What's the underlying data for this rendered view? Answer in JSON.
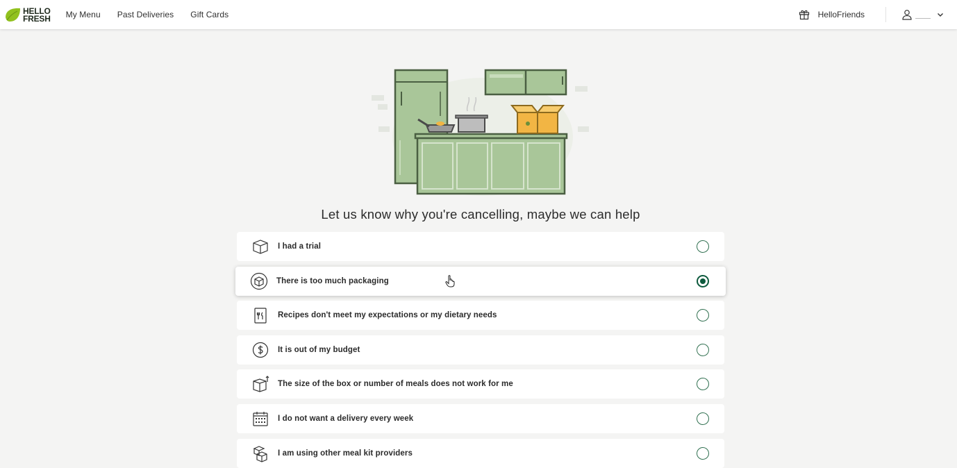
{
  "brand": {
    "line1": "HELLO",
    "line2": "FRESH",
    "leaf_color": "#91c11e"
  },
  "nav": [
    {
      "label": "My Menu"
    },
    {
      "label": "Past Deliveries"
    },
    {
      "label": "Gift Cards"
    }
  ],
  "header_right": {
    "friends_label": "HelloFriends"
  },
  "heading": "Let us know why you're cancelling, maybe we can help",
  "options": [
    {
      "label": "I had a trial",
      "icon": "box-icon",
      "selected": false
    },
    {
      "label": "There is too much packaging",
      "icon": "recycle-box-icon",
      "selected": true
    },
    {
      "label": "Recipes don't meet my expectations or my dietary needs",
      "icon": "recipe-card-icon",
      "selected": false
    },
    {
      "label": "It is out of my budget",
      "icon": "dollar-icon",
      "selected": false
    },
    {
      "label": "The size of the box or number of meals does not work for me",
      "icon": "box-size-icon",
      "selected": false
    },
    {
      "label": "I do not want a delivery every week",
      "icon": "calendar-icon",
      "selected": false
    },
    {
      "label": "I am using other meal kit providers",
      "icon": "boxes-icon",
      "selected": false
    }
  ],
  "colors": {
    "accent": "#0d5a3d",
    "illustration_green": "#a9c699",
    "box_orange": "#f2b544"
  }
}
